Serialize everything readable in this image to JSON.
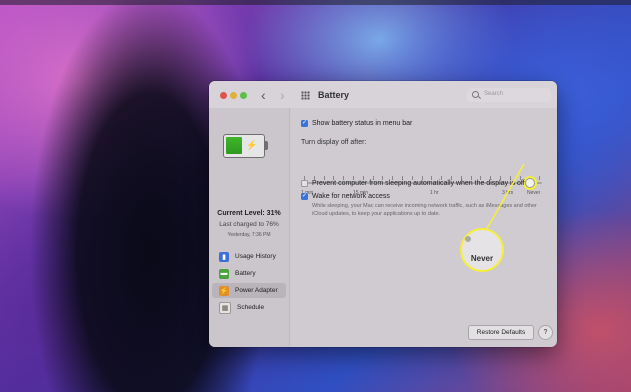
{
  "window": {
    "title": "Battery",
    "search_placeholder": "Search"
  },
  "sidebar": {
    "current_level": "Current Level: 31%",
    "last_charged": "Last charged to 76%",
    "charged_time": "Yesterday, 7:36 PM",
    "items": [
      {
        "label": "Usage History",
        "icon": "usage-history-icon"
      },
      {
        "label": "Battery",
        "icon": "battery-icon"
      },
      {
        "label": "Power Adapter",
        "icon": "power-adapter-icon",
        "selected": true
      },
      {
        "label": "Schedule",
        "icon": "schedule-icon"
      }
    ]
  },
  "main": {
    "show_battery_status": {
      "label": "Show battery status in menu bar",
      "checked": true
    },
    "turn_display_off_label": "Turn display off after:",
    "slider": {
      "tick_labels": [
        "1 min",
        "15 min",
        "1 hr",
        "3 hrs",
        "Never"
      ],
      "value": "Never"
    },
    "prevent_sleep": {
      "label": "Prevent computer from sleeping automatically when the display is off",
      "checked": false
    },
    "wake_network": {
      "label": "Wake for network access",
      "checked": true,
      "subtext": "While sleeping, your Mac can receive incoming network traffic, such as iMessages and other iCloud updates, to keep your applications up to date."
    },
    "restore_defaults": "Restore Defaults",
    "help": "?"
  },
  "callout": {
    "text": "Never"
  },
  "colors": {
    "accent_blue": "#3c73d9",
    "highlight_yellow": "#f6ef3a",
    "battery_green": "#3fb52a"
  }
}
